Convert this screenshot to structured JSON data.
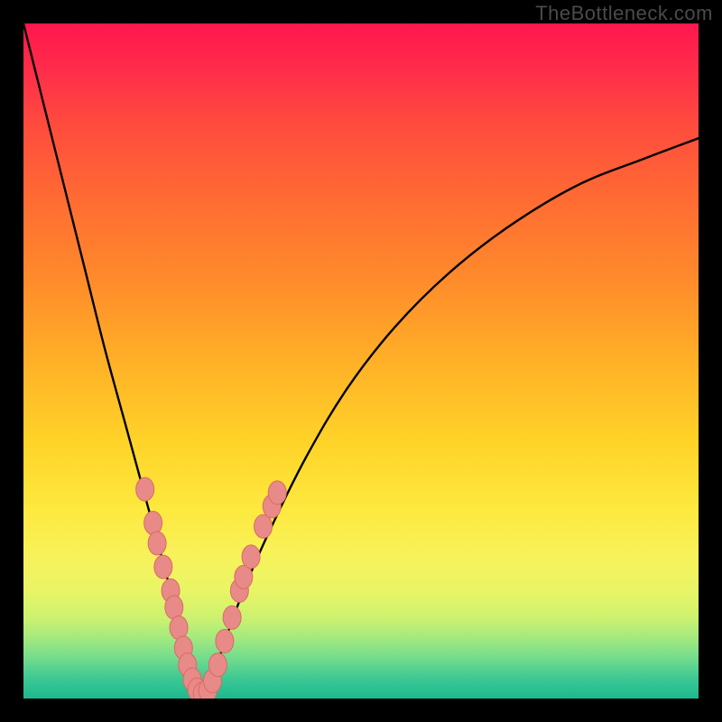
{
  "watermark": "TheBottleneck.com",
  "colors": {
    "bg_black": "#000000",
    "curve": "#000000",
    "marker_fill": "#e88a87",
    "marker_stroke": "#d96b65",
    "gradient_top": "#ff174e",
    "gradient_bottom": "#1db98f"
  },
  "chart_data": {
    "type": "line",
    "title": "",
    "xlabel": "",
    "ylabel": "",
    "xlim": [
      0,
      100
    ],
    "ylim": [
      0,
      100
    ],
    "grid": false,
    "note": "Axes are unlabeled; values are relative percentages estimated from pixel positions in a 748x748 plot area (0 = bottom/left, 100 = top/right).",
    "series": [
      {
        "name": "bottleneck-curve",
        "x": [
          0,
          3,
          6,
          9,
          12,
          15,
          18,
          21,
          23.5,
          25,
          26.5,
          28,
          30,
          33,
          37,
          42,
          48,
          55,
          63,
          72,
          82,
          92,
          100
        ],
        "y": [
          100,
          88,
          76,
          64,
          52,
          41,
          30,
          19,
          9,
          3,
          0.5,
          3,
          9,
          17,
          26,
          36,
          46,
          55,
          63,
          70,
          76,
          80,
          83
        ]
      }
    ],
    "markers": {
      "name": "sample-points",
      "note": "Salmon-coloured oval markers near the V-shaped minimum; estimated centers.",
      "points": [
        {
          "x": 18.0,
          "y": 31.0
        },
        {
          "x": 19.2,
          "y": 26.0
        },
        {
          "x": 19.8,
          "y": 23.0
        },
        {
          "x": 20.7,
          "y": 19.5
        },
        {
          "x": 21.8,
          "y": 16.0
        },
        {
          "x": 22.3,
          "y": 13.5
        },
        {
          "x": 23.0,
          "y": 10.5
        },
        {
          "x": 23.7,
          "y": 7.5
        },
        {
          "x": 24.3,
          "y": 5.0
        },
        {
          "x": 25.0,
          "y": 2.8
        },
        {
          "x": 25.7,
          "y": 1.3
        },
        {
          "x": 26.5,
          "y": 0.7
        },
        {
          "x": 27.3,
          "y": 1.2
        },
        {
          "x": 28.0,
          "y": 2.6
        },
        {
          "x": 28.8,
          "y": 5.0
        },
        {
          "x": 29.8,
          "y": 8.5
        },
        {
          "x": 30.9,
          "y": 12.0
        },
        {
          "x": 32.0,
          "y": 16.0
        },
        {
          "x": 32.6,
          "y": 18.0
        },
        {
          "x": 33.7,
          "y": 21.0
        },
        {
          "x": 35.5,
          "y": 25.5
        },
        {
          "x": 36.8,
          "y": 28.5
        },
        {
          "x": 37.6,
          "y": 30.5
        }
      ]
    }
  }
}
